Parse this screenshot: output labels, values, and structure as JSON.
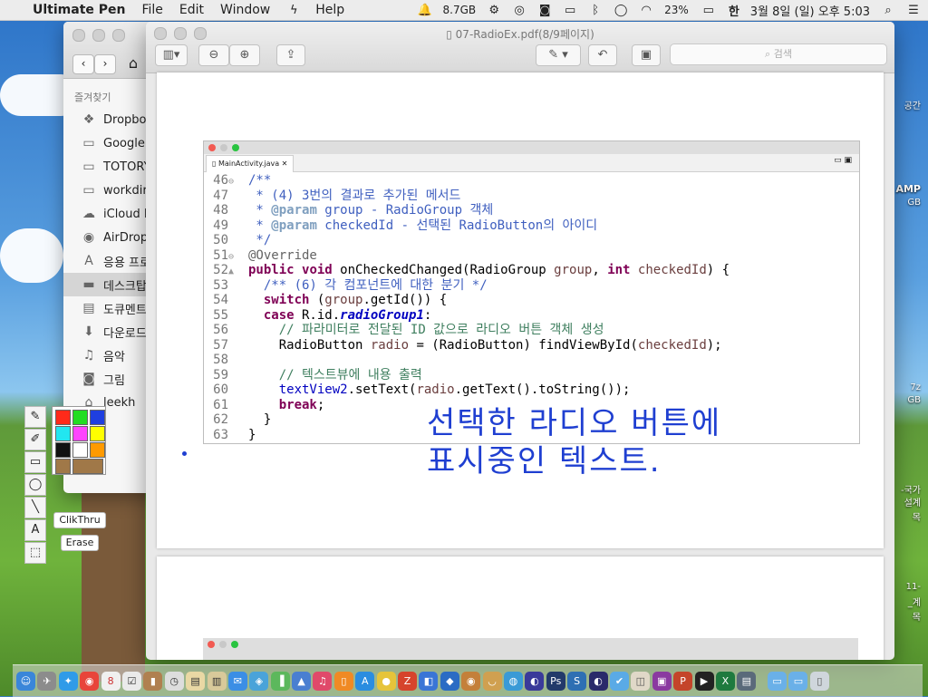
{
  "menubar": {
    "app_name": "Ultimate Pen",
    "menus": [
      "File",
      "Edit",
      "Window",
      "Help"
    ],
    "status": {
      "memory": "8.7GB",
      "battery": "23%",
      "input_source": "한",
      "datetime": "3월 8일 (일) 오후 5:03"
    }
  },
  "finder": {
    "section_header": "즐겨찾기",
    "items": [
      {
        "icon": "dropbox-icon",
        "label": "Dropbox"
      },
      {
        "icon": "folder-icon",
        "label": "Google D"
      },
      {
        "icon": "folder-icon",
        "label": "TOTORY"
      },
      {
        "icon": "folder-icon",
        "label": "workdir"
      },
      {
        "icon": "cloud-icon",
        "label": "iCloud D"
      },
      {
        "icon": "airdrop-icon",
        "label": "AirDrop"
      },
      {
        "icon": "apps-icon",
        "label": "응용 프로"
      },
      {
        "icon": "desktop-icon",
        "label": "데스크탑",
        "selected": true
      },
      {
        "icon": "documents-icon",
        "label": "도큐멘트"
      },
      {
        "icon": "download-icon",
        "label": "다운로드"
      },
      {
        "icon": "music-icon",
        "label": "음악"
      },
      {
        "icon": "pictures-icon",
        "label": "그림"
      },
      {
        "icon": "home-icon",
        "label": "leekh"
      }
    ]
  },
  "preview": {
    "title": "07-RadioEx.pdf(8/9페이지)",
    "search_placeholder": "검색"
  },
  "eclipse": {
    "tab_label": "MainActivity.java",
    "code_lines": [
      {
        "n": "46",
        "g": "⊖",
        "parts": [
          [
            "c-com",
            "/**"
          ]
        ]
      },
      {
        "n": "47",
        "g": "",
        "parts": [
          [
            "c-com",
            " * (4) 3번의 결과로 추가된 메서드"
          ]
        ]
      },
      {
        "n": "48",
        "g": "",
        "parts": [
          [
            "c-com",
            " * "
          ],
          [
            "c-tag",
            "@param"
          ],
          [
            "c-com",
            " group - RadioGroup 객체"
          ]
        ]
      },
      {
        "n": "49",
        "g": "",
        "parts": [
          [
            "c-com",
            " * "
          ],
          [
            "c-tag",
            "@param"
          ],
          [
            "c-com",
            " checkedId - 선택된 RadioButton의 아이디"
          ]
        ]
      },
      {
        "n": "50",
        "g": "",
        "parts": [
          [
            "c-com",
            " */"
          ]
        ]
      },
      {
        "n": "51",
        "g": "⊖",
        "parts": [
          [
            "c-ann",
            "@Override"
          ]
        ]
      },
      {
        "n": "52",
        "g": "▲",
        "parts": [
          [
            "c-kw",
            "public"
          ],
          [
            "c-plain",
            " "
          ],
          [
            "c-kw",
            "void"
          ],
          [
            "c-plain",
            " onCheckedChanged(RadioGroup "
          ],
          [
            "c-var",
            "group"
          ],
          [
            "c-plain",
            ", "
          ],
          [
            "c-kw",
            "int"
          ],
          [
            "c-plain",
            " "
          ],
          [
            "c-var",
            "checkedId"
          ],
          [
            "c-plain",
            ") {"
          ]
        ]
      },
      {
        "n": "53",
        "g": "",
        "parts": [
          [
            "c-com",
            "  /** (6) 각 컴포넌트에 대한 분기 */"
          ]
        ]
      },
      {
        "n": "54",
        "g": "",
        "parts": [
          [
            "c-plain",
            "  "
          ],
          [
            "c-kw",
            "switch"
          ],
          [
            "c-plain",
            " ("
          ],
          [
            "c-var",
            "group"
          ],
          [
            "c-plain",
            ".getId()) {"
          ]
        ]
      },
      {
        "n": "55",
        "g": "",
        "parts": [
          [
            "c-plain",
            "  "
          ],
          [
            "c-kw",
            "case"
          ],
          [
            "c-plain",
            " R.id."
          ],
          [
            "c-sfield",
            "radioGroup1"
          ],
          [
            "c-plain",
            ":"
          ]
        ]
      },
      {
        "n": "56",
        "g": "",
        "parts": [
          [
            "c-cmt",
            "    // 파라미터로 전달된 ID 값으로 라디오 버튼 객체 생성"
          ]
        ]
      },
      {
        "n": "57",
        "g": "",
        "parts": [
          [
            "c-plain",
            "    RadioButton "
          ],
          [
            "c-var",
            "radio"
          ],
          [
            "c-plain",
            " = (RadioButton) findViewById("
          ],
          [
            "c-var",
            "checkedId"
          ],
          [
            "c-plain",
            ");"
          ]
        ]
      },
      {
        "n": "58",
        "g": "",
        "parts": [
          [
            "c-plain",
            ""
          ]
        ]
      },
      {
        "n": "59",
        "g": "",
        "parts": [
          [
            "c-cmt",
            "    // 텍스트뷰에 내용 출력"
          ]
        ]
      },
      {
        "n": "60",
        "g": "",
        "parts": [
          [
            "c-plain",
            "    "
          ],
          [
            "c-field",
            "textView2"
          ],
          [
            "c-plain",
            ".setText("
          ],
          [
            "c-var",
            "radio"
          ],
          [
            "c-plain",
            ".getText().toString());"
          ]
        ]
      },
      {
        "n": "61",
        "g": "",
        "parts": [
          [
            "c-plain",
            "    "
          ],
          [
            "c-kw",
            "break"
          ],
          [
            "c-plain",
            ";"
          ]
        ]
      },
      {
        "n": "62",
        "g": "",
        "parts": [
          [
            "c-plain",
            "  }"
          ]
        ]
      },
      {
        "n": "63",
        "g": "",
        "parts": [
          [
            "c-plain",
            "}"
          ]
        ]
      }
    ]
  },
  "annotation": {
    "line1": "선택한 라디오 버튼에",
    "line2": "표시중인 텍스트.",
    "color": "#1f3fd1"
  },
  "pen": {
    "clickthru_label": "ClikThru",
    "erase_label": "Erase",
    "colors": [
      "#ff2a1a",
      "#22dd22",
      "#1f3fe0",
      "#22e6f0",
      "#ff44ff",
      "#ffff00",
      "#111111",
      "#ffffff",
      "#ff9a00",
      "#a07848"
    ]
  },
  "desktop_labels": [
    "공간",
    "AMP",
    "GB",
    "7z",
    "GB",
    "-국가",
    "설계",
    "목",
    "11-",
    "_계",
    "목"
  ]
}
